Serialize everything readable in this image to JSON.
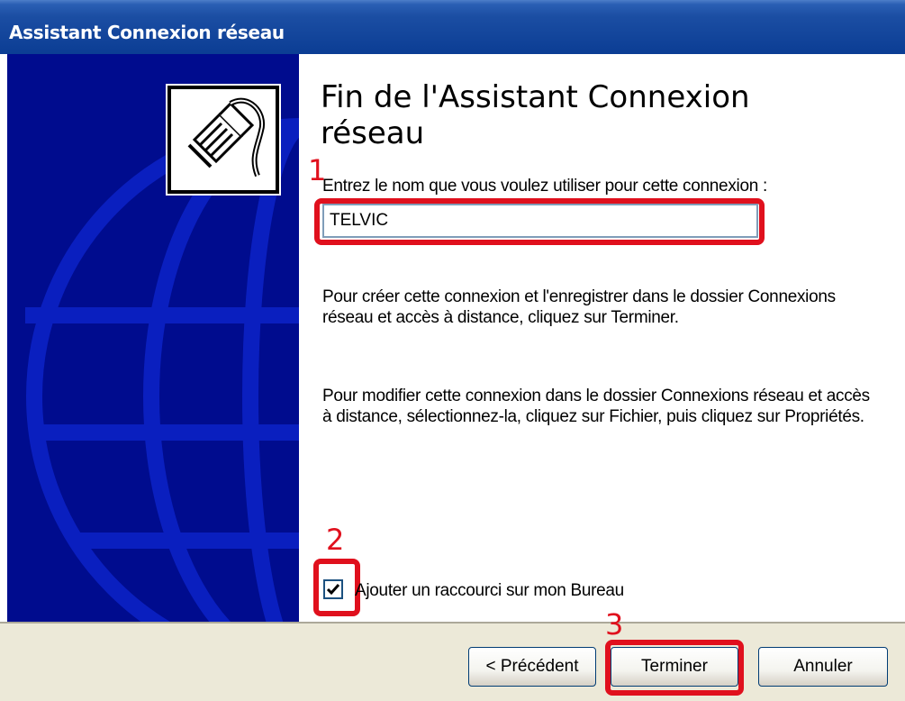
{
  "window": {
    "title": "Assistant Connexion réseau"
  },
  "wizard": {
    "heading": "Fin de l'Assistant Connexion réseau",
    "name_prompt": "Entrez le nom que vous voulez utiliser pour cette connexion :",
    "name_value": "TELVIC",
    "info_create": "Pour créer cette connexion et l'enregistrer dans le dossier Connexions réseau et accès à distance, cliquez sur Terminer.",
    "info_modify": "Pour modifier cette connexion dans le dossier Connexions réseau et accès à distance, sélectionnez-la, cliquez sur Fichier, puis cliquez sur Propriétés.",
    "shortcut_checkbox": {
      "label": "Ajouter un raccourci sur mon Bureau",
      "checked": true
    }
  },
  "buttons": {
    "back": "< Précédent",
    "finish": "Terminer",
    "cancel": "Annuler"
  },
  "annotations": {
    "marker1": "1",
    "marker2": "2",
    "marker3": "3",
    "color": "#e0101d"
  },
  "icons": {
    "wizard": "network-cable-icon",
    "background": "globe-graphic"
  }
}
